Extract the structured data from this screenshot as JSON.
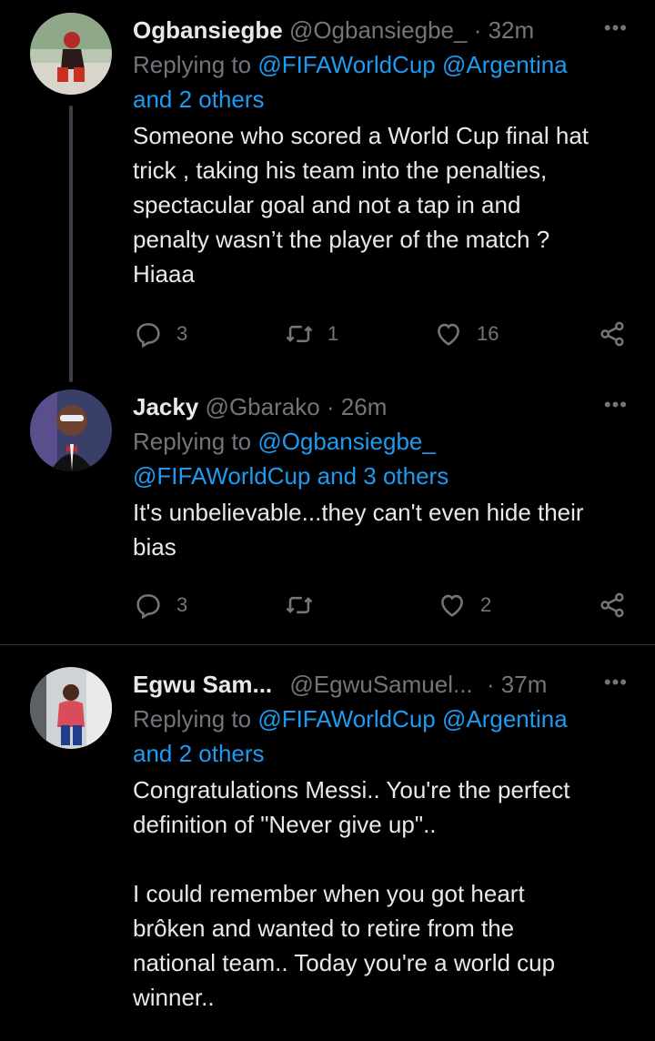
{
  "tweets": [
    {
      "name": "Ogbansiegbe",
      "handle": "@Ogbansiegbe_",
      "time": "· 32m",
      "replying_label": "Replying to",
      "mentions_line1": "@FIFAWorldCup @Argentina",
      "mentions_line2": "and 2 others",
      "text": "Someone who scored a World Cup final hat\ntrick , taking his team into the penalties,\nspectacular goal and not a tap in and\npenalty wasn’t the player of the match ?\nHiaaa",
      "replies": "3",
      "retweets": "1",
      "likes": "16"
    },
    {
      "name": "Jacky",
      "handle": "@Gbarako",
      "time": "· 26m",
      "replying_label": "Replying to",
      "mentions_line1": "@Ogbansiegbe_",
      "mentions_line2": "@FIFAWorldCup and 3 others",
      "text": "It's unbelievable...they can't even hide their\nbias",
      "replies": "3",
      "retweets": "",
      "likes": "2"
    },
    {
      "name": "Egwu Sam...",
      "handle": "@EgwuSamuel...",
      "time": "· 37m",
      "replying_label": "Replying to",
      "mentions_line1": "@FIFAWorldCup @Argentina",
      "mentions_line2": "and 2 others",
      "text": "Congratulations Messi.. You're the perfect\ndefinition of \"Never give up\"..\n\nI could remember when you got heart\nbrôken and wanted to retire from the\nnational team.. Today you're a world cup\nwinner..",
      "replies": "",
      "retweets": "",
      "likes": ""
    }
  ],
  "more_label": "•••",
  "colors": {
    "background": "#000000",
    "text": "#e7e9ea",
    "muted": "#71767b",
    "link": "#1d9bf0",
    "divider": "#2f3336"
  }
}
